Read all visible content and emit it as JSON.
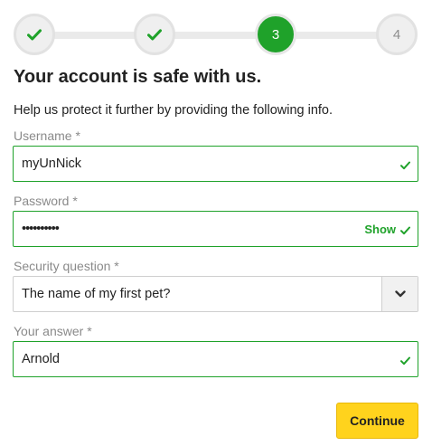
{
  "stepper": {
    "steps": [
      {
        "label": "",
        "state": "completed",
        "icon": "checkmark-icon"
      },
      {
        "label": "",
        "state": "completed",
        "icon": "checkmark-icon"
      },
      {
        "label": "3",
        "state": "current"
      },
      {
        "label": "4",
        "state": "upcoming"
      }
    ]
  },
  "heading": "Your account is safe with us.",
  "intro": "Help us protect it further by providing the following info.",
  "form": {
    "username": {
      "label": "Username *",
      "value": "myUnNick",
      "valid": true
    },
    "password": {
      "label": "Password *",
      "value": "••••••••••",
      "show_label": "Show",
      "valid": true
    },
    "security_question": {
      "label": "Security question *",
      "value": "The name of my first pet?",
      "icon": "chevron-down-icon"
    },
    "answer": {
      "label": "Your answer *",
      "value": "Arnold",
      "valid": true
    }
  },
  "continue_label": "Continue",
  "colors": {
    "accent_green": "#1fa22a",
    "button_yellow": "#ffd31d",
    "label_gray": "#8a8a8a"
  }
}
